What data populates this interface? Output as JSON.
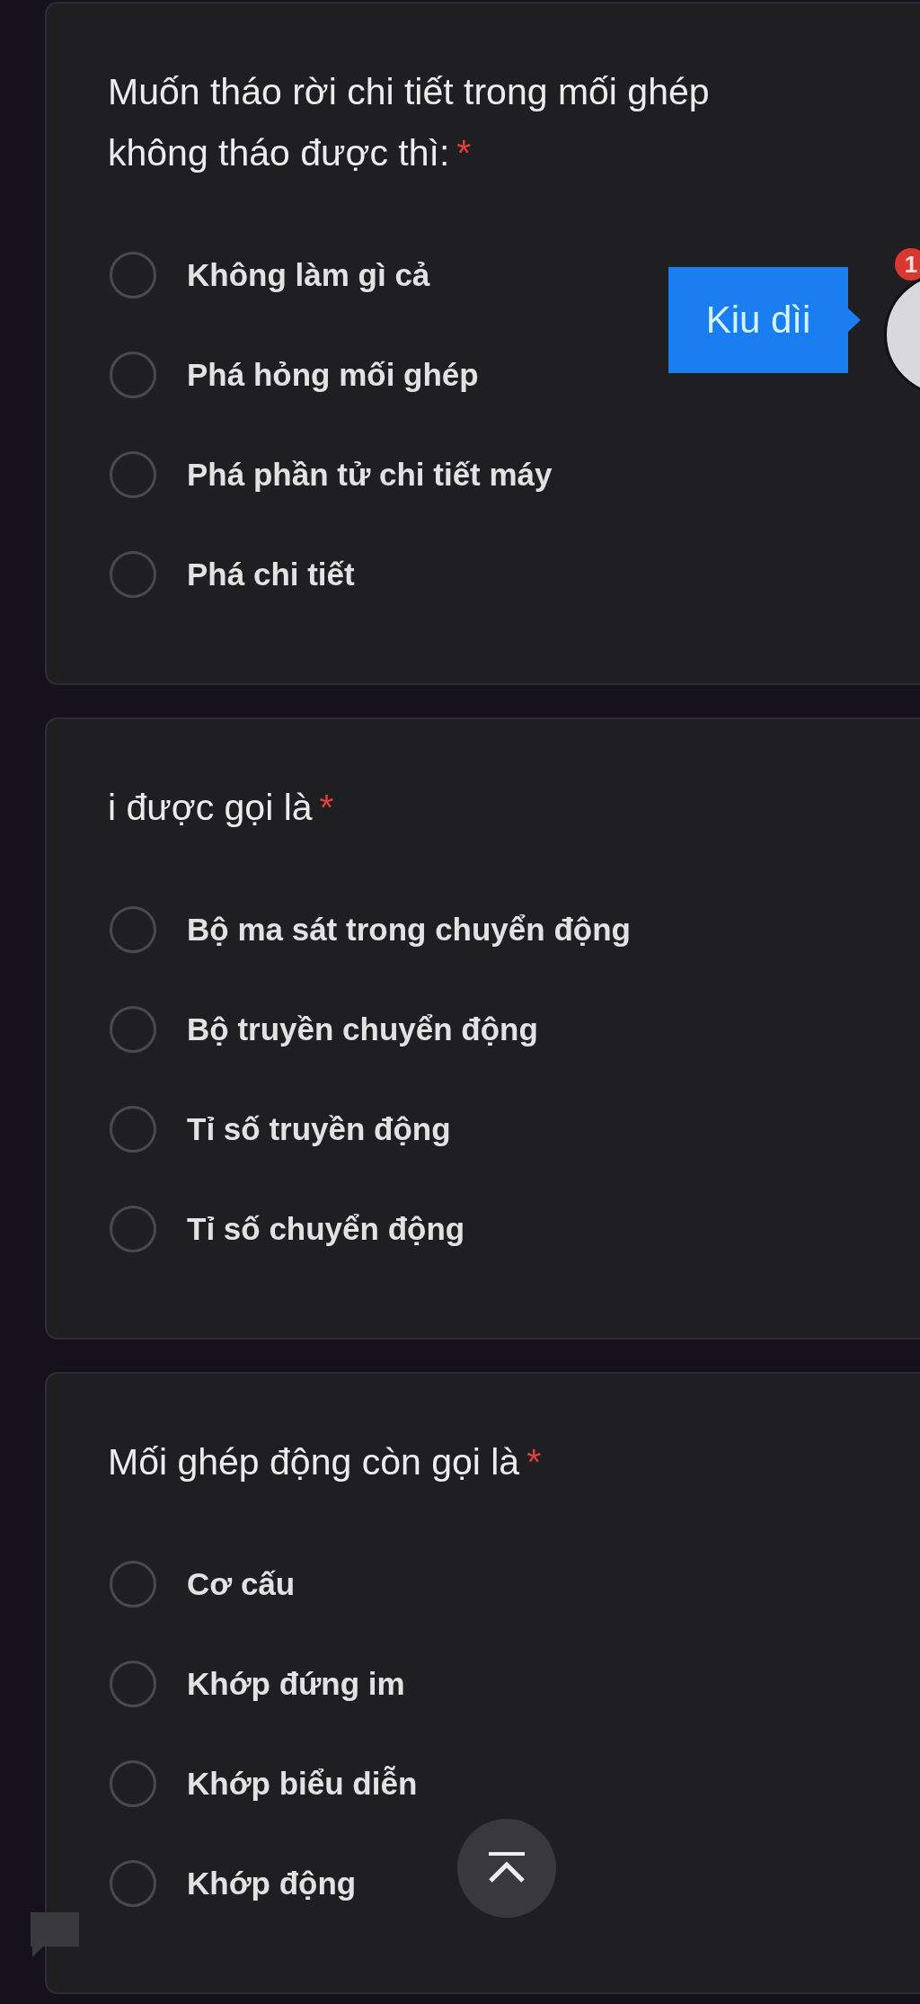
{
  "questions": [
    {
      "title": "Muốn tháo rời chi tiết trong mối ghép không tháo được thì:",
      "required_mark": "*",
      "options": [
        {
          "label": "Không làm gì cả",
          "selected": false
        },
        {
          "label": "Phá hỏng mối ghép",
          "selected": false
        },
        {
          "label": "Phá phần tử chi tiết máy",
          "selected": false
        },
        {
          "label": "Phá chi tiết",
          "selected": false
        }
      ]
    },
    {
      "title": "i được gọi là",
      "required_mark": "*",
      "options": [
        {
          "label": "Bộ ma sát trong chuyển động",
          "selected": false
        },
        {
          "label": "Bộ truyền chuyển động",
          "selected": false
        },
        {
          "label": "Tỉ số truyền động",
          "selected": false
        },
        {
          "label": "Tỉ số chuyển động",
          "selected": false
        }
      ]
    },
    {
      "title": "Mối ghép động còn gọi là",
      "required_mark": "*",
      "options": [
        {
          "label": "Cơ cấu",
          "selected": false
        },
        {
          "label": "Khớp đứng im",
          "selected": false
        },
        {
          "label": "Khớp biểu diễn",
          "selected": false
        },
        {
          "label": "Khớp động",
          "selected": false
        }
      ]
    }
  ],
  "chat_bubble": {
    "tooltip": "Kiu dìi",
    "badge": "1"
  }
}
